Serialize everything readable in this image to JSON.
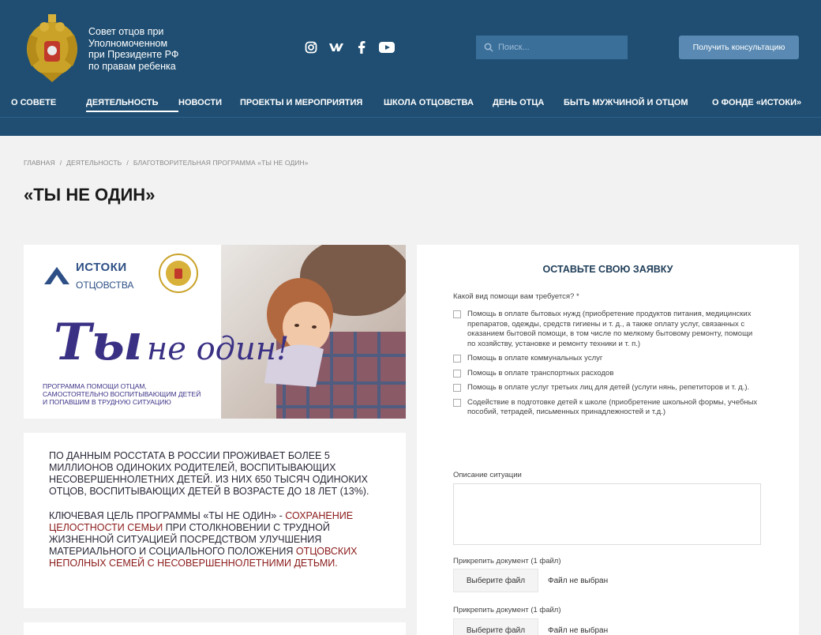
{
  "header": {
    "org_name": "Совет отцов при Уполномоченном при Президенте РФ по правам ребенка",
    "org_lines": [
      "Совет отцов при",
      "Уполномоченном",
      "при Президенте РФ",
      "по правам ребенка"
    ],
    "social": [
      "instagram-icon",
      "vk-icon",
      "facebook-icon",
      "youtube-icon"
    ],
    "search_placeholder": "Поиск...",
    "consult_label": "Получить консультацию",
    "colors": {
      "header_bg": "#1f4e72",
      "button_bg": "#5a8ab3"
    }
  },
  "nav": {
    "items": [
      {
        "label": "О СОВЕТЕ",
        "active": false
      },
      {
        "label": "ДЕЯТЕЛЬНОСТЬ",
        "active": true
      },
      {
        "label": "НОВОСТИ",
        "active": false
      },
      {
        "label": "ПРОЕКТЫ И МЕРОПРИЯТИЯ",
        "active": false
      },
      {
        "label": "ШКОЛА ОТЦОВСТВА",
        "active": false
      },
      {
        "label": "ДЕНЬ ОТЦА",
        "active": false
      },
      {
        "label": "БЫТЬ МУЖЧИНОЙ И ОТЦОМ",
        "active": false
      },
      {
        "label": "О ФОНДЕ «ИСТОКИ»",
        "active": false
      }
    ]
  },
  "breadcrumb": [
    "ГЛАВНАЯ",
    "ДЕЯТЕЛЬНОСТЬ",
    "БЛАГОТВОРИТЕЛЬНАЯ ПРОГРАММА «ТЫ НЕ ОДИН»"
  ],
  "page": {
    "title": "«ТЫ НЕ ОДИН»"
  },
  "banner": {
    "logo_line1": "ИСТОКИ",
    "logo_line2": "ОТЦОВСТВА",
    "hand_big": "Ты",
    "hand_small": "не один!",
    "program_lines": [
      "ПРОГРАММА ПОМОЩИ ОТЦАМ,",
      "САМОСТОЯТЕЛЬНО ВОСПИТЫВАЮЩИМ ДЕТЕЙ",
      "И ПОПАВШИМ В ТРУДНУЮ СИТУАЦИЮ"
    ]
  },
  "text_card": {
    "p1": "ПО ДАННЫМ РОССТАТА В РОССИИ ПРОЖИВАЕТ БОЛЕЕ 5 МИЛЛИОНОВ ОДИНОКИХ РОДИТЕЛЕЙ, ВОСПИТЫВАЮЩИХ НЕСОВЕРШЕННОЛЕТНИХ ДЕТЕЙ. ИЗ НИХ 650 ТЫСЯЧ ОДИНОКИХ ОТЦОВ, ВОСПИТЫВАЮЩИХ ДЕТЕЙ В ВОЗРАСТЕ ДО 18 ЛЕТ (13%).",
    "p2_a": "КЛЮЧЕВАЯ ЦЕЛЬ ПРОГРАММЫ «ТЫ НЕ ОДИН» - ",
    "p2_b": "СОХРАНЕНИЕ ЦЕЛОСТНОСТИ СЕМЬИ",
    "p2_c": " ПРИ СТОЛКНОВЕНИИ С ТРУДНОЙ ЖИЗНЕННОЙ СИТУАЦИЕЙ ПОСРЕДСТВОМ УЛУЧШЕНИЯ МАТЕРИАЛЬНОГО И СОЦИАЛЬНОГО ПОЛОЖЕНИЯ ",
    "p2_d": "ОТЦОВСКИХ НЕПОЛНЫХ СЕМЕЙ С НЕСОВЕРШЕННОЛЕТНИМИ ДЕТЬМИ.",
    "accent_color": "#8b1a1a"
  },
  "form": {
    "title": "ОСТАВЬТЕ СВОЮ ЗАЯВКУ",
    "question": "Какой вид помощи вам требуется? *",
    "options": [
      "Помощь в оплате бытовых нужд (приобретение продуктов питания, медицинских препаратов, одежды, средств гигиены и т. д., а также оплату услуг, связанных с оказанием бытовой помощи, в том числе по мелкому бытовому ремонту, помощи по хозяйству, установке и ремонту техники и т. п.)",
      "Помощь в оплате коммунальных услуг",
      "Помощь в оплате транспортных расходов",
      "Помощь в оплате услуг третьих лиц для детей (услуги нянь, репетиторов и т. д.).",
      "Содействие в подготовке детей к школе (приобретение школьной формы, учебных пособий, тетрадей, письменных принадлежностей и т.д.)"
    ],
    "description_label": "Описание ситуации",
    "attach_label": "Прикрепить документ (1 файл)",
    "file_button": "Выберите файл",
    "file_status": "Файл не выбран"
  }
}
